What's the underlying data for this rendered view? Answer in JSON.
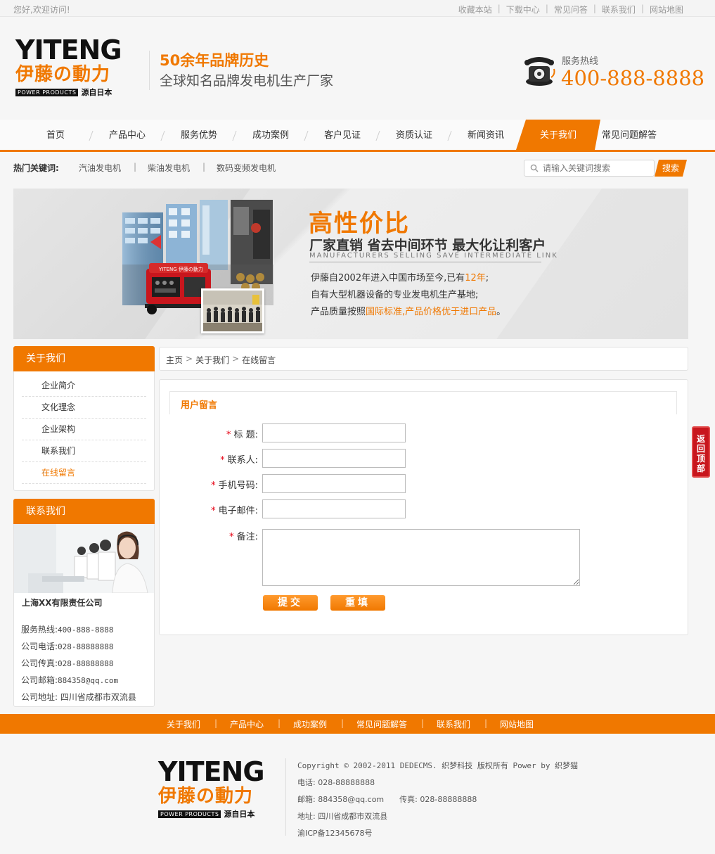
{
  "topbar": {
    "welcome": "您好,欢迎访问!",
    "links": [
      "收藏本站",
      "下载中心",
      "常见问答",
      "联系我们",
      "网站地图"
    ]
  },
  "header": {
    "logo_en": "YITENG",
    "logo_cn": "伊藤の動力",
    "logo_pp": "POWER PRODUCTS",
    "logo_jp": "源自日本",
    "slogan1": "50余年品牌历史",
    "slogan2": "全球知名品牌发电机生产厂家",
    "hotline_label": "服务热线",
    "hotline": "400-888-8888"
  },
  "nav": {
    "items": [
      "首页",
      "产品中心",
      "服务优势",
      "成功案例",
      "客户见证",
      "资质认证",
      "新闻资讯",
      "关于我们",
      "常见问题解答"
    ],
    "active": "关于我们"
  },
  "keywords": {
    "label": "热门关键词:",
    "items": [
      "汽油发电机",
      "柴油发电机",
      "数码变频发电机"
    ],
    "search_placeholder": "请输入关键词搜索",
    "search_button": "搜索"
  },
  "banner": {
    "title": "高性价比",
    "subtitle": "厂家直销 省去中间环节 最大化让利客户",
    "english": "MANUFACTURERS SELLING SAVE INTERMEDIATE LINK",
    "line1_a": "伊藤自2002年进入中国市场至今,已有",
    "line1_hl": "12年",
    "line1_b": ";",
    "line2": "自有大型机器设备的专业发电机生产基地;",
    "line3_a": "产品质量按照",
    "line3_hl": "国际标准,产品价格优于进口产品",
    "line3_b": "。",
    "gen_logo": "YITENG 伊藤の動力"
  },
  "sidebar": {
    "about_title": "关于我们",
    "items": [
      "企业简介",
      "文化理念",
      "企业架构",
      "联系我们",
      "在线留言"
    ],
    "active": "在线留言",
    "contact_title": "联系我们",
    "company": "上海XX有限责任公司",
    "hotline_label": "服务热线:",
    "hotline": "400-888-8888",
    "phone_label": "公司电话:",
    "phone": "028-88888888",
    "fax_label": "公司传真:",
    "fax": "028-88888888",
    "email_label": "公司邮箱:",
    "email": "884358@qq.com",
    "address": "公司地址: 四川省成都市双流县"
  },
  "content": {
    "breadcrumb": [
      "主页",
      "关于我们",
      "在线留言"
    ],
    "section_title": "用户留言",
    "fields": [
      {
        "star": "*",
        "label": "标  题:"
      },
      {
        "star": "*",
        "label": "联系人:"
      },
      {
        "star": "*",
        "label": "手机号码:"
      },
      {
        "star": "*",
        "label": "电子邮件:"
      },
      {
        "star": "*",
        "label": "备注:"
      }
    ],
    "submit": "提交",
    "reset": "重填"
  },
  "back_to_top": "返回顶部",
  "footer": {
    "links": [
      "关于我们",
      "产品中心",
      "成功案例",
      "常见问题解答",
      "联系我们",
      "网站地图"
    ],
    "copyright": "Copyright © 2002-2011 DEDECMS. 织梦科技 版权所有 Power by 织梦猫",
    "phone": "电话: 028-88888888",
    "email": "邮箱: 884358@qq.com",
    "fax": "传真: 028-88888888",
    "address": "地址: 四川省成都市双流县",
    "icp": "渝ICP备12345678号"
  },
  "colors": {
    "accent": "#f07800",
    "totop": "#c8161d"
  }
}
